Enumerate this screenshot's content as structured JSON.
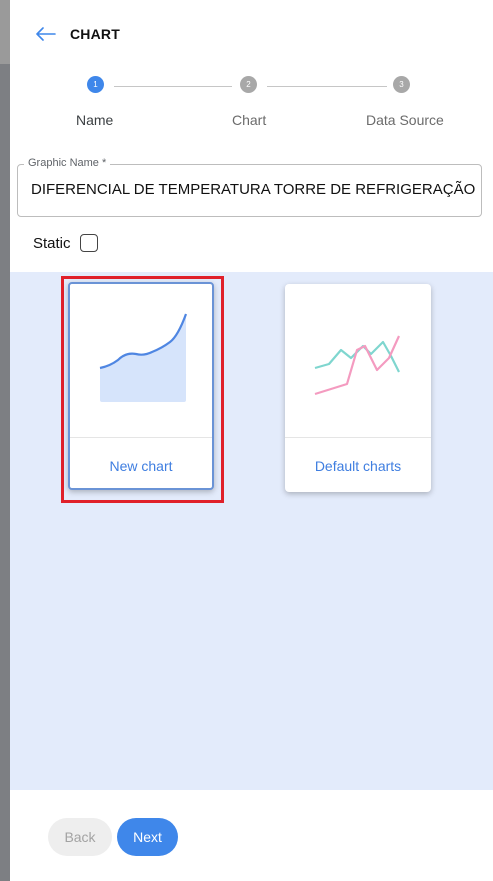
{
  "header": {
    "title": "CHART"
  },
  "stepper": {
    "steps": [
      {
        "number": "1",
        "label": "Name",
        "active": true
      },
      {
        "number": "2",
        "label": "Chart",
        "active": false
      },
      {
        "number": "3",
        "label": "Data Source",
        "active": false
      }
    ],
    "active_color": "#3f87ea",
    "inactive_color": "#a8a8a8"
  },
  "form": {
    "graphic_name_label": "Graphic Name *",
    "graphic_name_value": "DIFERENCIAL DE TEMPERATURA TORRE DE REFRIGERAÇÃO",
    "static_label": "Static",
    "static_checked": false
  },
  "options": [
    {
      "label": "New chart",
      "icon": "area-chart-icon",
      "selected": true
    },
    {
      "label": "Default charts",
      "icon": "line-chart-icon",
      "selected": false
    }
  ],
  "footer": {
    "back_label": "Back",
    "next_label": "Next"
  },
  "colors": {
    "accent": "#3f87ea",
    "selection_outline": "#e0202a",
    "background_area": "#e3ebfb"
  }
}
